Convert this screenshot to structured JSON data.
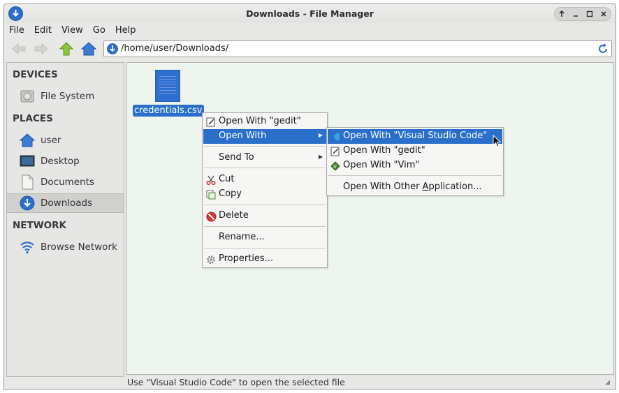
{
  "window": {
    "title": "Downloads - File Manager"
  },
  "menubar": {
    "items": [
      "File",
      "Edit",
      "View",
      "Go",
      "Help"
    ]
  },
  "toolbar": {
    "location": "/home/user/Downloads/"
  },
  "sidebar": {
    "devices_header": "DEVICES",
    "places_header": "PLACES",
    "network_header": "NETWORK",
    "devices": [
      {
        "label": "File System",
        "icon": "drive-icon"
      }
    ],
    "places": [
      {
        "label": "user",
        "icon": "home-icon"
      },
      {
        "label": "Desktop",
        "icon": "desktop-icon"
      },
      {
        "label": "Documents",
        "icon": "documents-icon"
      },
      {
        "label": "Downloads",
        "icon": "downloads-icon"
      }
    ],
    "network": [
      {
        "label": "Browse Network",
        "icon": "wifi-icon"
      }
    ]
  },
  "content": {
    "files": [
      {
        "name": "credentials.csv",
        "icon": "text-file-icon",
        "selected": true
      }
    ]
  },
  "context_menu": {
    "open_with_gedit": "Open With \"gedit\"",
    "open_with": "Open With",
    "send_to": "Send To",
    "cut": "Cut",
    "copy": "Copy",
    "delete": "Delete",
    "rename": "Rename...",
    "properties": "Properties..."
  },
  "submenu": {
    "vscode": "Open With \"Visual Studio Code\"",
    "gedit": "Open With \"gedit\"",
    "vim": "Open With \"Vim\"",
    "other_prefix": "Open With Other ",
    "other_underlined": "A",
    "other_suffix": "pplication..."
  },
  "statusbar": {
    "text": "Use \"Visual Studio Code\" to open the selected file"
  },
  "colors": {
    "selection": "#2a6fc9",
    "content_bg": "#eef4ee"
  }
}
